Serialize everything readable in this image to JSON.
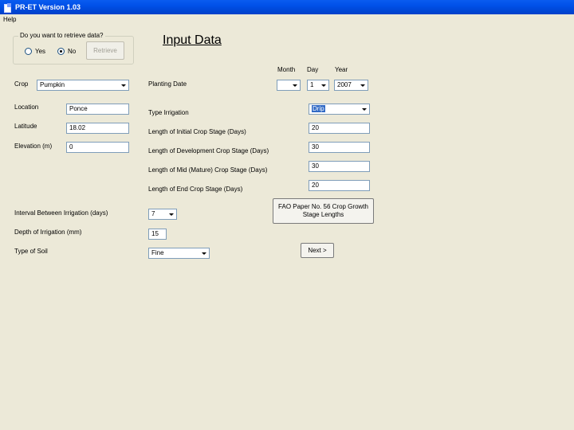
{
  "window": {
    "title": "PR-ET Version 1.03"
  },
  "menu": {
    "help": "Help"
  },
  "retrieve": {
    "legend": "Do you want to retrieve data?",
    "yes_label": "Yes",
    "no_label": "No",
    "selected": "No",
    "retrieve_button": "Retrieve"
  },
  "heading": "Input Data",
  "planting": {
    "label": "Planting Date",
    "month_header": "Month",
    "day_header": "Day",
    "year_header": "Year",
    "month": "",
    "day": "1",
    "year": "2007"
  },
  "left": {
    "crop_label": "Crop",
    "crop_value": "Pumpkin",
    "location_label": "Location",
    "location_value": "Ponce",
    "latitude_label": "Latitude",
    "latitude_value": "18.02",
    "elevation_label": "Elevation (m)",
    "elevation_value": "0",
    "interval_label": "Interval Between Irrigation (days)",
    "interval_value": "7",
    "depth_label": "Depth of Irrigation (mm)",
    "depth_value": "15",
    "soil_label": "Type of Soil",
    "soil_value": "Fine"
  },
  "right": {
    "irrigation_label": "Type Irrigation",
    "irrigation_value": "Drip",
    "initial_label": "Length of Initial Crop Stage (Days)",
    "initial_value": "20",
    "development_label": "Length of Development Crop Stage (Days)",
    "development_value": "30",
    "mid_label": "Length of Mid (Mature) Crop Stage (Days)",
    "mid_value": "30",
    "end_label": "Length of End Crop Stage (Days)",
    "end_value": "20",
    "fao_button": "FAO Paper No. 56 Crop Growth Stage Lengths",
    "next_button": "Next >"
  }
}
